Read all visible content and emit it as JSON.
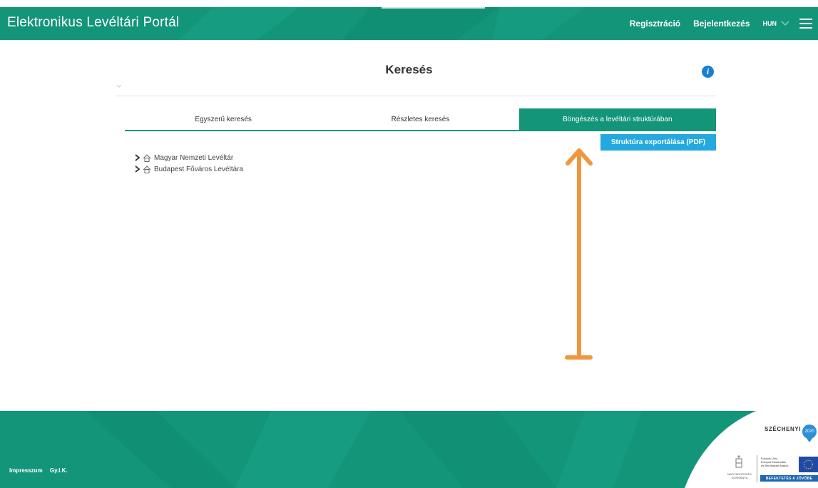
{
  "header": {
    "brand": "Elektronikus Levéltári Portál",
    "register": "Regisztráció",
    "login": "Bejelentkezés",
    "lang": "HUN"
  },
  "search": {
    "title": "Keresés",
    "info": "i"
  },
  "tabs": [
    {
      "label": "Egyszerű keresés",
      "active": false
    },
    {
      "label": "Részletes keresés",
      "active": false
    },
    {
      "label": "Böngészés a levéltári struktúrában",
      "active": true
    }
  ],
  "export_button": "Struktúra exportálása (PDF)",
  "tree": [
    {
      "label": "Magyar Nemzeti Levéltár"
    },
    {
      "label": "Budapest Főváros Levéltára"
    }
  ],
  "footer": {
    "links": [
      "Impresszum",
      "Gy.I.K."
    ],
    "szechenyi": "SZÉCHENYI",
    "szechenyi_year": "2020",
    "crest_text": "MAGYARORSZÁG KORMÁNYA",
    "eu_text": [
      "Európai Unió",
      "Európai Strukturális",
      "és Beruházási Alapok"
    ],
    "eu_bar": "BEFEKTETÉS A JÖVŐBE"
  },
  "colors": {
    "primary": "#13957a",
    "button": "#23a8df",
    "annotation": "#f0973e",
    "info": "#1a7fd0"
  }
}
